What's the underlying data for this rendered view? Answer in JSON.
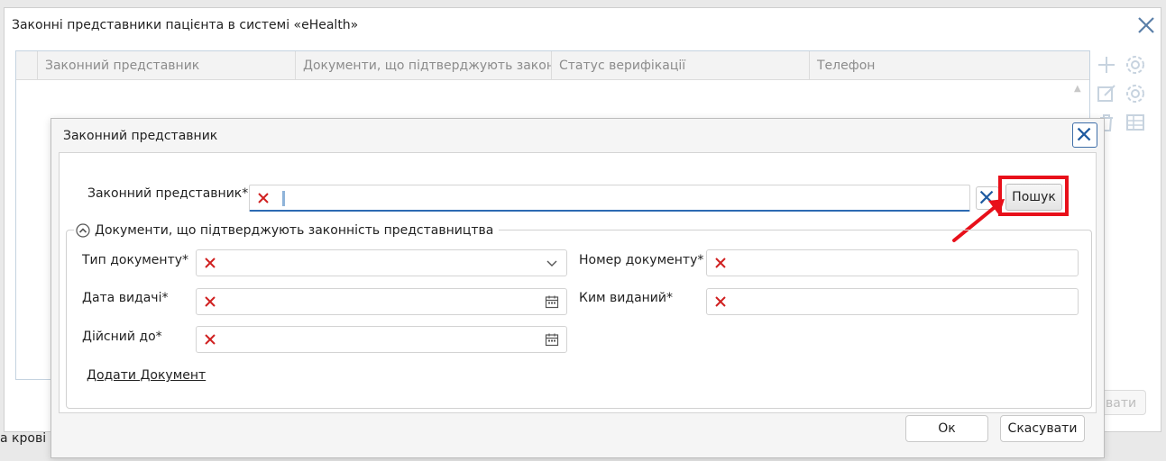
{
  "outer_window": {
    "title": "Законні представники пацієнта в системі «eHealth»",
    "grid_columns": [
      "Законний представник",
      "Документи, що підтверджують законні",
      "Статус верифікації",
      "Телефон"
    ],
    "partial_button_label": "вати",
    "footer_partial_text": "а крові"
  },
  "dialog": {
    "title": "Законний представник",
    "representative": {
      "label": "Законний представник*",
      "value": ""
    },
    "search_button_label": "Пошук",
    "documents_section": {
      "title": "Документи, що підтверджують законність представництва",
      "doc_type": {
        "label": "Тип документу*",
        "value": ""
      },
      "doc_number": {
        "label": "Номер документу*",
        "value": ""
      },
      "issue_date": {
        "label": "Дата видачі*",
        "value": ""
      },
      "issued_by": {
        "label": "Ким виданий*",
        "value": ""
      },
      "valid_until": {
        "label": "Дійсний до*",
        "value": ""
      },
      "add_document_link": "Додати Документ"
    },
    "ok_label": "Ок",
    "cancel_label": "Скасувати"
  },
  "colors": {
    "highlight": "#e8101a",
    "required_mark": "#d02020",
    "accent": "#1e5aa0"
  }
}
